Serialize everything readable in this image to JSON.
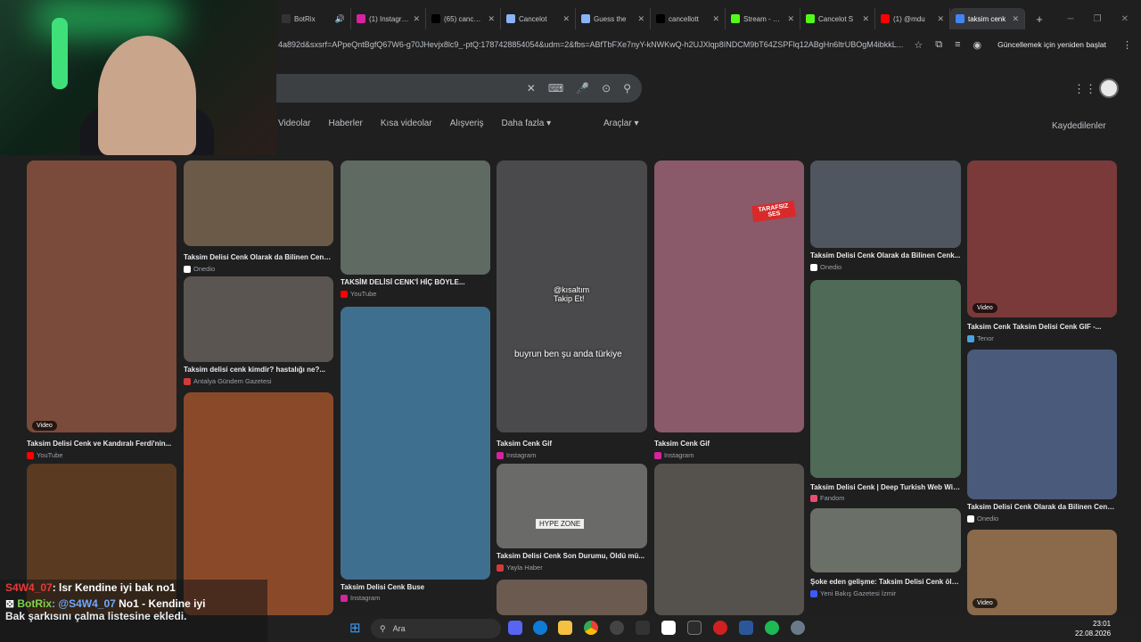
{
  "browser": {
    "tabs": [
      {
        "label": "BotRix",
        "favicon_color": "#333333",
        "active": false
      },
      {
        "label": "(1) Instagram",
        "favicon_color": "#d6249f",
        "active": false
      },
      {
        "label": "(65) cancelot",
        "favicon_color": "#000000",
        "active": false
      },
      {
        "label": "Cancelot",
        "favicon_color": "#8ab4f8",
        "active": false
      },
      {
        "label": "Guess the",
        "favicon_color": "#8ab4f8",
        "active": false
      },
      {
        "label": "cancellott",
        "favicon_color": "#000000",
        "active": false
      },
      {
        "label": "Stream - Kick",
        "favicon_color": "#53fc18",
        "active": false
      },
      {
        "label": "Cancelot S",
        "favicon_color": "#53fc18",
        "active": false
      },
      {
        "label": "(1) @mdu",
        "favicon_color": "#ff0000",
        "active": false
      },
      {
        "label": "taksim cenk",
        "favicon_color": "#4285f4",
        "active": true
      }
    ],
    "new_tab_symbol": "+",
    "url": "4a892d&sxsrf=APpeQntBgfQ67W6-g70JHevjx8lc9_-ptQ:1787428854054&udm=2&fbs=ABfTbFXe7nyY-kNWKwQ-h2UJXlqp8INDCM9bT64ZSPFlq12ABgHn6ltrUBOgM4ibkkL...",
    "update_button": "Güncellemek için yeniden başlat"
  },
  "search": {
    "clear_symbol": "✕",
    "filters": [
      "Videolar",
      "Haberler",
      "Kısa videolar",
      "Alışveriş",
      "Daha fazla ▾"
    ],
    "tools": "Araçlar ▾",
    "saved": "Kaydedilenler"
  },
  "results": [
    {
      "caption": "Taksim Delisi Cenk ve Kandıralı Ferdi'nin...",
      "source": "YouTube",
      "source_color": "#ff0000",
      "video": "Video",
      "img_color": "#7a4a3a"
    },
    {
      "caption": "Taksim Delisi Cenk Olarak da Bilinen Cenk...",
      "source": "Onedio",
      "source_color": "#ffffff",
      "video": "",
      "img_color": "#6b5a48"
    },
    {
      "caption": "Taksim delisi cenk kimdir? hastalığı ne?...",
      "source": "Antalya Gündem Gazetesi",
      "source_color": "#d33b3b",
      "video": "",
      "img_color": "#5a5550"
    },
    {
      "caption": "TAKSİM DELİSİ CENK'İ HİÇ BÖYLE...",
      "source": "YouTube",
      "source_color": "#ff0000",
      "video": "",
      "img_color": "#5f6a62"
    },
    {
      "caption": "Taksim Delisi Cenk Buse",
      "source": "Instagram",
      "source_color": "#d6249f",
      "video": "",
      "img_color": "#3f6f8f"
    },
    {
      "caption": "Taksim Cenk Gif",
      "source": "Instagram",
      "source_color": "#d6249f",
      "video": "",
      "img_color": "#4a4a4c"
    },
    {
      "caption": "Taksim Delisi Cenk Son Durumu, Öldü mü...",
      "source": "Yayla Haber",
      "source_color": "#d33b3b",
      "video": "",
      "img_color": "#6a6a68"
    },
    {
      "caption": "Taksim Cenk Gif",
      "source": "Instagram",
      "source_color": "#d6249f",
      "video": "",
      "img_color": "#8a5a6a"
    },
    {
      "caption": "Taksim Delisi Cenk Olarak da Bilinen Cenk...",
      "source": "Onedio",
      "source_color": "#ffffff",
      "video": "",
      "img_color": "#4f5660"
    },
    {
      "caption": "Taksim Delisi Cenk | Deep Turkish Web Wik...",
      "source": "Fandom",
      "source_color": "#e84d70",
      "video": "",
      "img_color": "#4f6a56"
    },
    {
      "caption": "Şoke eden gelişme: Taksim Delisi Cenk öld...",
      "source": "Yeni Bakış Gazetesi İzmir",
      "source_color": "#3d5afe",
      "video": "",
      "img_color": "#6a7068"
    },
    {
      "caption": "Taksim Cenk Taksim Delisi Cenk GIF -...",
      "source": "Tenor",
      "source_color": "#4aa3df",
      "video": "Video",
      "img_color": "#7a3a3a"
    },
    {
      "caption": "Taksim Delisi Cenk Olarak da Bilinen Cenk...",
      "source": "Onedio",
      "source_color": "#ffffff",
      "video": "",
      "img_color": "#4a5a7a"
    }
  ],
  "overlays": {
    "badge": "TARAFSIZ SES",
    "sub1": "@kısaltım Takip Et!",
    "sub2": "buyrun ben şu anda türkiye",
    "hype": "HYPE ZONE"
  },
  "chat": {
    "user1": "S4W4_07",
    "msg1": ": lsr Kendine iyi bak no1",
    "bot": "BotRix",
    "mention": ": @S4W4_07",
    "msg2a": " No1 - Kendine iyi",
    "msg2b": "Bak şarkısını çalma listesine ekledi."
  },
  "taskbar": {
    "search_label": "Ara",
    "time": "23:01",
    "date": "22.08.2026"
  }
}
